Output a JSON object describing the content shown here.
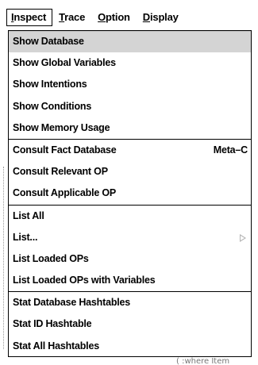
{
  "menubar": {
    "items": [
      {
        "label": "Inspect",
        "mnemonic": "I",
        "rest": "nspect"
      },
      {
        "label": "Trace",
        "mnemonic": "T",
        "rest": "race"
      },
      {
        "label": "Option",
        "mnemonic": "O",
        "rest": "ption"
      },
      {
        "label": "Display",
        "mnemonic": "D",
        "rest": "isplay"
      }
    ],
    "active_index": 0
  },
  "menu": {
    "groups": [
      [
        {
          "label": "Show Database"
        },
        {
          "label": "Show Global Variables"
        },
        {
          "label": "Show Intentions"
        },
        {
          "label": "Show Conditions"
        },
        {
          "label": "Show Memory Usage"
        }
      ],
      [
        {
          "label": "Consult Fact Database",
          "shortcut": "Meta–C"
        },
        {
          "label": "Consult Relevant OP"
        },
        {
          "label": "Consult Applicable OP"
        }
      ],
      [
        {
          "label": "List All"
        },
        {
          "label": "List...",
          "has_submenu": true
        },
        {
          "label": "List Loaded OPs"
        },
        {
          "label": "List Loaded OPs with Variables"
        }
      ],
      [
        {
          "label": "Stat Database Hashtables"
        },
        {
          "label": "Stat ID Hashtable"
        },
        {
          "label": "Stat All Hashtables"
        }
      ]
    ],
    "highlighted_item": "Show Database"
  },
  "background": {
    "partial_text": "( :where Item"
  }
}
